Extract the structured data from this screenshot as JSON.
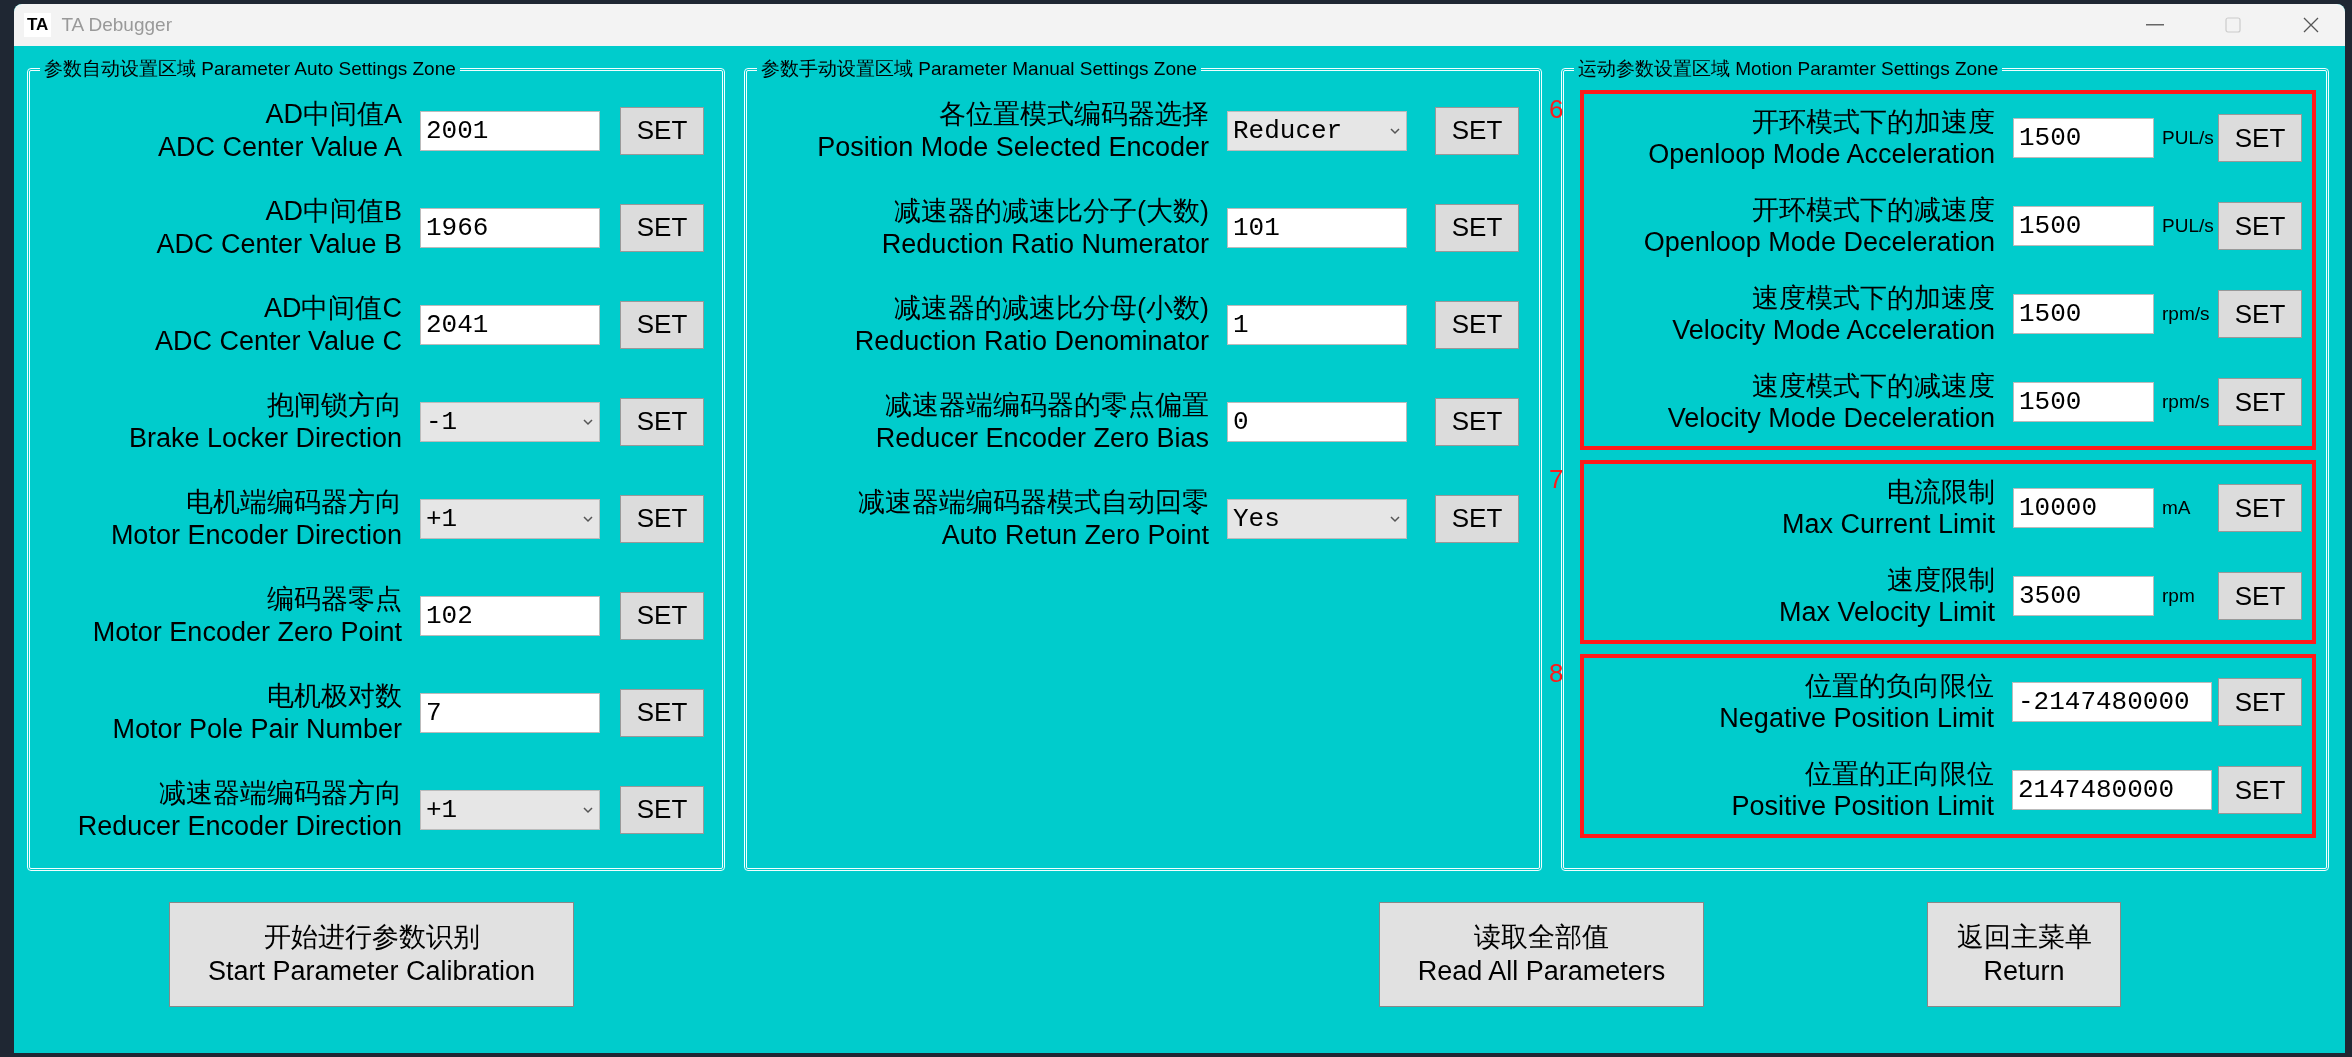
{
  "window": {
    "logo": "TA",
    "title": "TA Debugger"
  },
  "panels": [
    {
      "title": "参数自动设置区域 Parameter Auto Settings Zone",
      "rows": [
        {
          "kind": "text",
          "label_cn": "AD中间值A",
          "label_en": "ADC Center Value A",
          "value": "2001",
          "button": "SET"
        },
        {
          "kind": "text",
          "label_cn": "AD中间值B",
          "label_en": "ADC Center Value B",
          "value": "1966",
          "button": "SET"
        },
        {
          "kind": "text",
          "label_cn": "AD中间值C",
          "label_en": "ADC Center Value C",
          "value": "2041",
          "button": "SET"
        },
        {
          "kind": "select",
          "label_cn": "抱闸锁方向",
          "label_en": "Brake Locker Direction",
          "value": "-1",
          "button": "SET"
        },
        {
          "kind": "select",
          "label_cn": "电机端编码器方向",
          "label_en": "Motor Encoder Direction",
          "value": "+1",
          "button": "SET"
        },
        {
          "kind": "text",
          "label_cn": "编码器零点",
          "label_en": "Motor Encoder Zero Point",
          "value": "102",
          "button": "SET"
        },
        {
          "kind": "text",
          "label_cn": "电机极对数",
          "label_en": "Motor Pole Pair Number",
          "value": "7",
          "button": "SET"
        },
        {
          "kind": "select",
          "label_cn": "减速器端编码器方向",
          "label_en": "Reducer Encoder Direction",
          "value": "+1",
          "button": "SET"
        }
      ]
    },
    {
      "title": "参数手动设置区域 Parameter Manual Settings Zone",
      "rows": [
        {
          "kind": "select",
          "label_cn": "各位置模式编码器选择",
          "label_en": "Position Mode Selected Encoder",
          "value": "Reducer",
          "button": "SET"
        },
        {
          "kind": "text",
          "label_cn": "减速器的减速比分子(大数)",
          "label_en": "Reduction Ratio Numerator",
          "value": "101",
          "button": "SET"
        },
        {
          "kind": "text",
          "label_cn": "减速器的减速比分母(小数)",
          "label_en": "Reduction Ratio Denominator",
          "value": "1",
          "button": "SET"
        },
        {
          "kind": "text",
          "label_cn": "减速器端编码器的零点偏置",
          "label_en": "Reducer Encoder Zero Bias",
          "value": "0",
          "button": "SET"
        },
        {
          "kind": "select",
          "label_cn": "减速器端编码器模式自动回零",
          "label_en": "Auto Retun Zero Point",
          "value": "Yes",
          "button": "SET"
        }
      ]
    },
    {
      "title": "运动参数设置区域 Motion Paramter Settings Zone",
      "groups": [
        {
          "number": "6",
          "rows": [
            {
              "label_cn": "开环模式下的加速度",
              "label_en": "Openloop Mode Acceleration",
              "value": "1500",
              "unit": "PUL/s",
              "button": "SET"
            },
            {
              "label_cn": "开环模式下的减速度",
              "label_en": "Openloop Mode Deceleration",
              "value": "1500",
              "unit": "PUL/s",
              "button": "SET"
            },
            {
              "label_cn": "速度模式下的加速度",
              "label_en": "Velocity Mode Acceleration",
              "value": "1500",
              "unit": "rpm/s",
              "button": "SET"
            },
            {
              "label_cn": "速度模式下的减速度",
              "label_en": "Velocity Mode Deceleration",
              "value": "1500",
              "unit": "rpm/s",
              "button": "SET"
            }
          ]
        },
        {
          "number": "7",
          "rows": [
            {
              "label_cn": "电流限制",
              "label_en": "Max Current Limit",
              "value": "10000",
              "unit": "mA",
              "button": "SET"
            },
            {
              "label_cn": "速度限制",
              "label_en": "Max Velocity Limit",
              "value": "3500",
              "unit": "rpm",
              "button": "SET"
            }
          ]
        },
        {
          "number": "8",
          "rows": [
            {
              "label_cn": "位置的负向限位",
              "label_en": "Negative Position Limit",
              "value": "-2147480000",
              "button": "SET"
            },
            {
              "label_cn": "位置的正向限位",
              "label_en": "Positive Position Limit",
              "value": "2147480000",
              "button": "SET"
            }
          ]
        }
      ]
    }
  ],
  "actions": [
    {
      "label_cn": "开始进行参数识别",
      "label_en": "Start Parameter Calibration"
    },
    {
      "label_cn": "读取全部值",
      "label_en": "Read All Parameters"
    },
    {
      "label_cn": "返回主菜单",
      "label_en": "Return"
    }
  ]
}
